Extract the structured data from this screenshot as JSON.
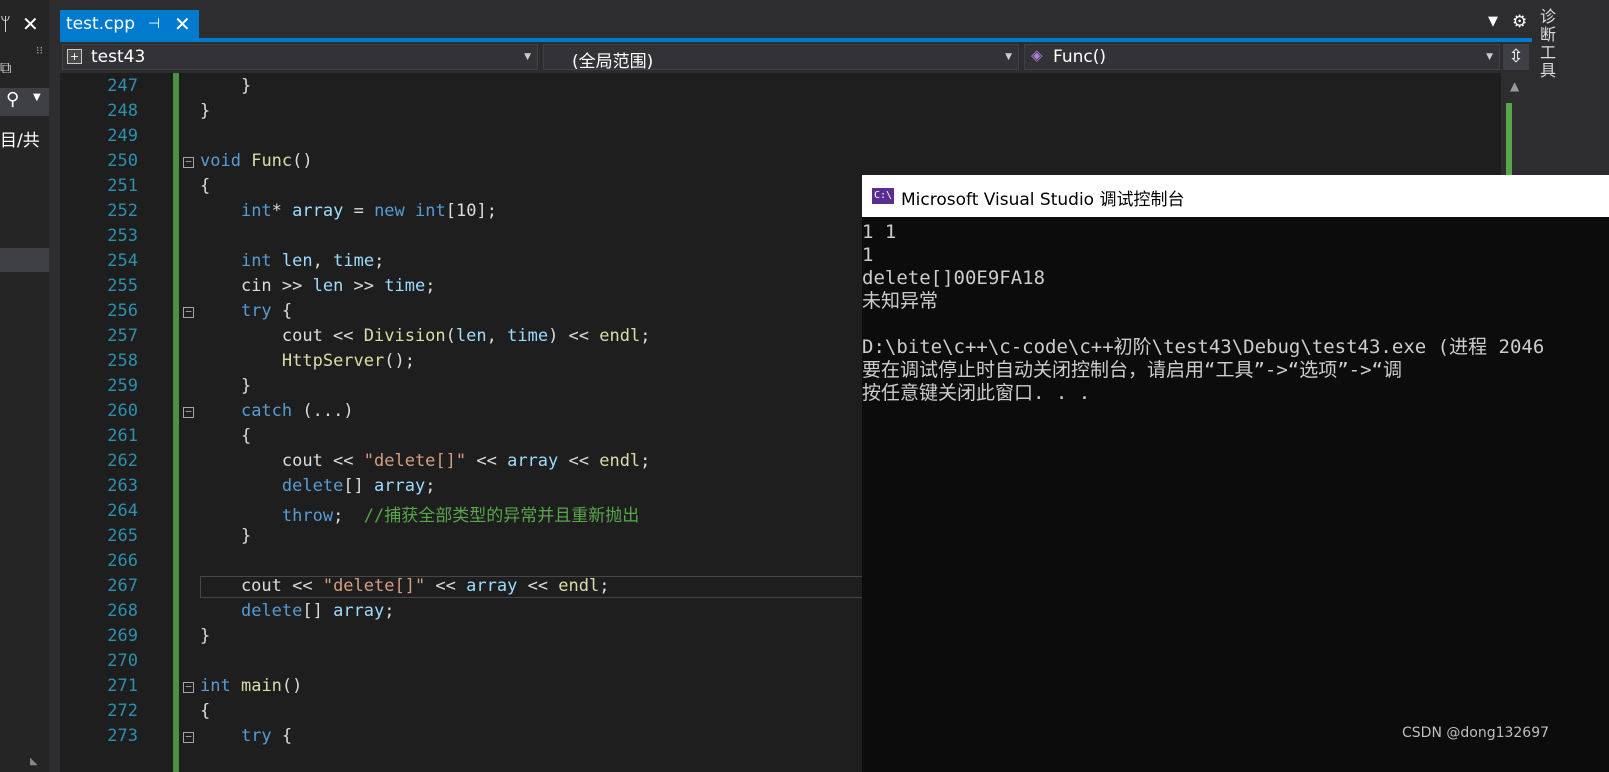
{
  "sidebar": {
    "pin_icon": "pin-icon",
    "close_icon": "close-icon",
    "search_icon": "search-icon",
    "project_text": "目/共"
  },
  "tab": {
    "name": "test.cpp",
    "pin": "⊣",
    "close": "✕"
  },
  "nav": {
    "project": "test43",
    "scope": "(全局范围)",
    "function": "Func()"
  },
  "right_panel": {
    "label": "诊断工具"
  },
  "editor": {
    "lines": [
      {
        "n": "247",
        "html": "    <span style='color:#dcdcdc'>}</span>"
      },
      {
        "n": "248",
        "html": "}"
      },
      {
        "n": "249",
        "html": ""
      },
      {
        "n": "250",
        "html": "<span class='kw'>void</span> <span class='fn'>Func</span>()"
      },
      {
        "n": "251",
        "html": "{"
      },
      {
        "n": "252",
        "html": "    <span class='kw'>int</span>* <span class='var'>array</span> = <span class='kw'>new</span> <span class='kw'>int</span>[10];"
      },
      {
        "n": "253",
        "html": ""
      },
      {
        "n": "254",
        "html": "    <span class='kw'>int</span> <span class='var'>len</span>, <span class='var'>time</span>;"
      },
      {
        "n": "255",
        "html": "    cin &gt;&gt; <span class='var'>len</span> &gt;&gt; <span class='var'>time</span>;"
      },
      {
        "n": "256",
        "html": "    <span class='kw'>try</span> {"
      },
      {
        "n": "257",
        "html": "        cout &lt;&lt; <span class='fn'>Division</span>(<span class='var'>len</span>, <span class='var'>time</span>) &lt;&lt; <span class='fn'>endl</span>;"
      },
      {
        "n": "258",
        "html": "        <span class='fn'>HttpServer</span>();"
      },
      {
        "n": "259",
        "html": "    }"
      },
      {
        "n": "260",
        "html": "    <span class='kw'>catch</span> (...)"
      },
      {
        "n": "261",
        "html": "    {"
      },
      {
        "n": "262",
        "html": "        cout &lt;&lt; <span class='str'>\"delete[]\"</span> &lt;&lt; <span class='var'>array</span> &lt;&lt; <span class='fn'>endl</span>;"
      },
      {
        "n": "263",
        "html": "        <span class='kw'>delete</span>[] <span class='var'>array</span>;"
      },
      {
        "n": "264",
        "html": "        <span class='kw'>throw</span>;  <span class='cm'>//捕获全部类型的异常并且重新抛出</span>"
      },
      {
        "n": "265",
        "html": "    }"
      },
      {
        "n": "266",
        "html": ""
      },
      {
        "n": "267",
        "html": "    cout &lt;&lt; <span class='str'>\"delete[]\"</span> &lt;&lt; <span class='var'>array</span> &lt;&lt; <span class='fn'>endl</span>;"
      },
      {
        "n": "268",
        "html": "    <span class='kw'>delete</span>[] <span class='var'>array</span>;"
      },
      {
        "n": "269",
        "html": "}"
      },
      {
        "n": "270",
        "html": ""
      },
      {
        "n": "271",
        "html": "<span class='kw'>int</span> <span class='fn'>main</span>()"
      },
      {
        "n": "272",
        "html": "{"
      },
      {
        "n": "273",
        "html": "    <span class='kw'>try</span> {"
      }
    ]
  },
  "console": {
    "title": "Microsoft Visual Studio 调试控制台",
    "icon_text": "C:\\",
    "output": [
      "1 1",
      "1",
      "delete[]00E9FA18",
      "未知异常",
      "",
      "D:\\bite\\c++\\c-code\\c++初阶\\test43\\Debug\\test43.exe (进程 2046",
      "要在调试停止时自动关闭控制台，请启用“工具”->“选项”->“调",
      "按任意键关闭此窗口. . ."
    ]
  },
  "watermark": "CSDN @dong132697",
  "colors": {
    "accent": "#007acc",
    "keyword": "#569cd6",
    "function": "#dcdcaa",
    "comment": "#57a64a",
    "string": "#d69d85"
  }
}
